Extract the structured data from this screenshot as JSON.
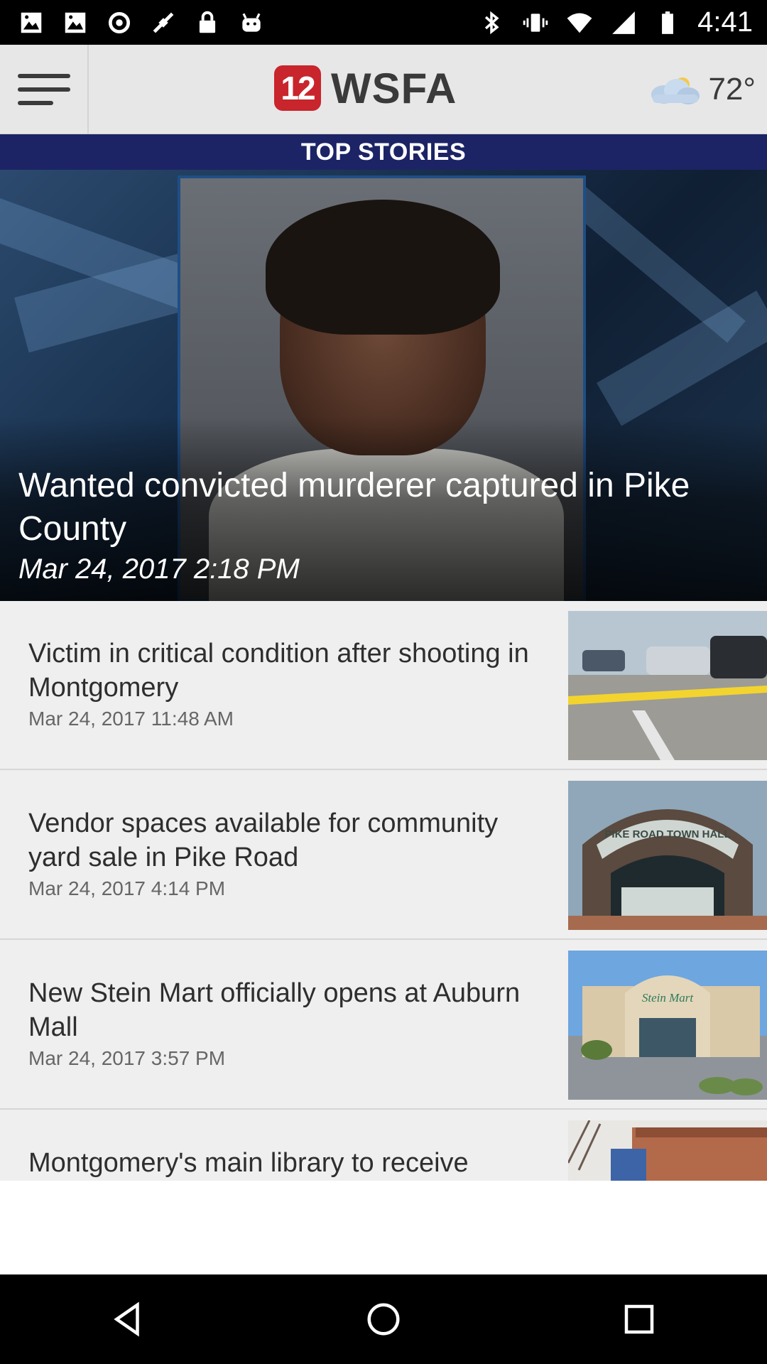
{
  "status_bar": {
    "time": "4:41",
    "left_icons": [
      "gallery-icon",
      "gallery-icon",
      "settings-icon",
      "gps-fake-icon",
      "lock-icon",
      "android-icon"
    ],
    "right_icons": [
      "bluetooth-icon",
      "vibrate-icon",
      "wifi-icon",
      "cell-signal-icon",
      "battery-icon"
    ]
  },
  "header": {
    "logo_number": "12",
    "logo_text": "WSFA",
    "temperature": "72°",
    "weather_icon": "cloudy-icon"
  },
  "banner": {
    "label": "TOP STORIES"
  },
  "hero": {
    "title": "Wanted convicted murderer captured in Pike County",
    "date": "Mar 24, 2017 2:18 PM"
  },
  "stories": [
    {
      "title": "Victim in critical condition after shooting in Montgomery",
      "date": "Mar 24, 2017 11:48 AM"
    },
    {
      "title": "Vendor spaces available for community yard sale in Pike Road",
      "date": "Mar 24, 2017 4:14 PM"
    },
    {
      "title": "New Stein Mart officially opens at Auburn Mall",
      "date": "Mar 24, 2017 3:57 PM"
    },
    {
      "title": "Montgomery's main library to receive",
      "date": ""
    }
  ],
  "thumbs": {
    "town_hall_sign": "PIKE ROAD TOWN HALL",
    "stein_mart_sign": "Stein Mart"
  },
  "colors": {
    "banner_bg": "#1c2466",
    "logo_red": "#c9252c",
    "header_bg": "#e7e7e7",
    "list_bg": "#efefef"
  },
  "nav": [
    "back-icon",
    "home-icon",
    "recents-icon"
  ]
}
